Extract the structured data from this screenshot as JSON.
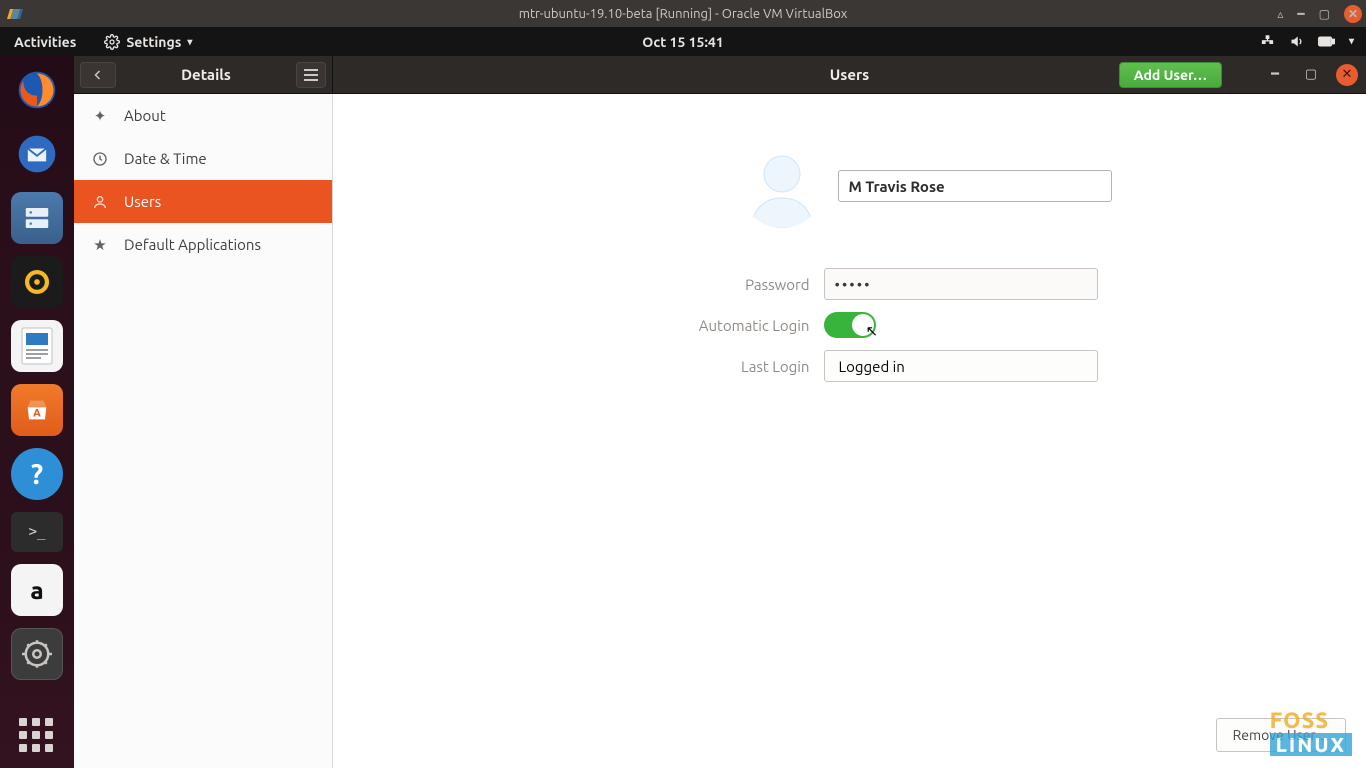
{
  "virtualbox": {
    "title": "mtr-ubuntu-19.10-beta [Running] - Oracle VM VirtualBox"
  },
  "gnome": {
    "activities": "Activities",
    "app_menu": "Settings",
    "clock": "Oct 15  15:41"
  },
  "settings_window": {
    "sidebar_title": "Details",
    "panel_title": "Users",
    "add_user_label": "Add User…",
    "sidebar": [
      {
        "id": "about",
        "label": "About"
      },
      {
        "id": "datetime",
        "label": "Date & Time"
      },
      {
        "id": "users",
        "label": "Users"
      },
      {
        "id": "defapps",
        "label": "Default Applications"
      }
    ],
    "user": {
      "name": "M Travis Rose",
      "password_label": "Password",
      "password_masked": "•••••",
      "autologin_label": "Automatic Login",
      "autologin_on": true,
      "lastlogin_label": "Last Login",
      "lastlogin_value": "Logged in"
    },
    "remove_user_label": "Remove User…"
  },
  "watermark": {
    "line1": "FOSS",
    "line2": "LINUX"
  }
}
